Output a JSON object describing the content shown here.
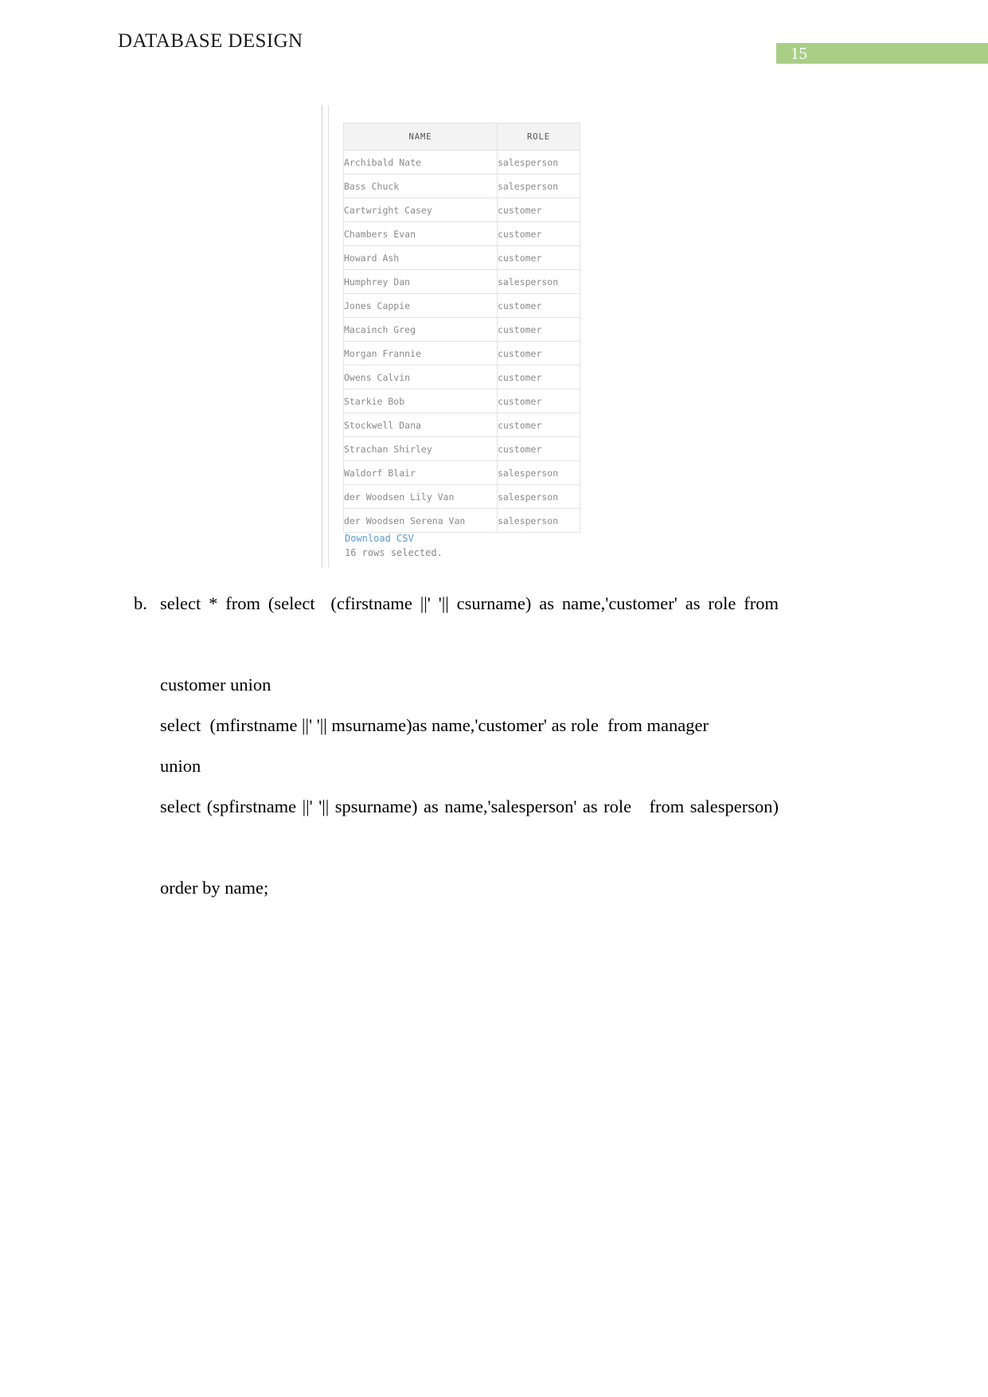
{
  "header": {
    "title": "DATABASE DESIGN",
    "page_number": "15",
    "badge_color": "#a9cf86"
  },
  "result_set": {
    "columns": [
      "NAME",
      "ROLE"
    ],
    "rows": [
      {
        "name": "Archibald Nate",
        "role": "salesperson"
      },
      {
        "name": "Bass Chuck",
        "role": "salesperson"
      },
      {
        "name": "Cartwright Casey",
        "role": "customer"
      },
      {
        "name": "Chambers Evan",
        "role": "customer"
      },
      {
        "name": "Howard  Ash",
        "role": "customer"
      },
      {
        "name": "Humphrey Dan",
        "role": "salesperson"
      },
      {
        "name": "Jones Cappie",
        "role": "customer"
      },
      {
        "name": "Macainch Greg",
        "role": "customer"
      },
      {
        "name": "Morgan Frannie",
        "role": "customer"
      },
      {
        "name": "Owens Calvin",
        "role": "customer"
      },
      {
        "name": "Starkie Bob",
        "role": "customer"
      },
      {
        "name": "Stockwell Dana",
        "role": "customer"
      },
      {
        "name": "Strachan Shirley",
        "role": "customer"
      },
      {
        "name": "Waldorf Blair",
        "role": "salesperson"
      },
      {
        "name": "der Woodsen Lily Van",
        "role": "salesperson"
      },
      {
        "name": "der Woodsen Serena Van",
        "role": "salesperson"
      }
    ],
    "download_label": "Download CSV",
    "status_text": "16 rows selected.",
    "link_color": "#5b9bd5"
  },
  "sql_item": {
    "marker": "b.",
    "lines": [
      "select * from (select  (cfirstname ||' '|| csurname) as name,'customer' as role from",
      "customer union",
      "select  (mfirstname ||' '|| msurname)as name,'customer' as role  from manager",
      "union",
      "select (spfirstname ||' '|| spsurname) as name,'salesperson' as role   from salesperson)",
      "order by name;"
    ]
  }
}
